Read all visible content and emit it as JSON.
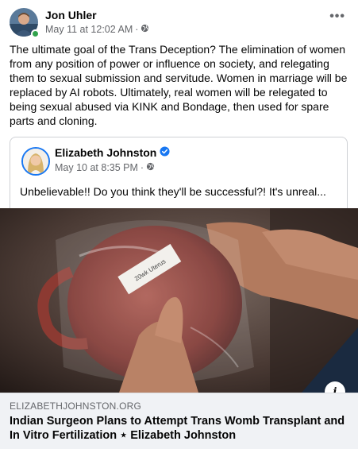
{
  "post": {
    "author_name": "Jon Uhler",
    "timestamp": "May 11 at 12:02 AM",
    "separator": "·",
    "more_label": "•••",
    "privacy_icon": "globe-icon",
    "text": "The ultimate goal of the Trans Deception? The elimination of women from any position of power or influence on society, and relegating them to sexual submission and servitude. Women in marriage will be replaced by AI robots. Ultimately, real women will be relegated to being sexual abused via KINK and Bondage, then used for spare parts and cloning."
  },
  "shared": {
    "author_name": "Elizabeth Johnston",
    "verified_icon": "verified-badge-icon",
    "timestamp": "May 10 at 8:35 PM",
    "separator": "·",
    "privacy_icon": "globe-icon",
    "text": "Unbelievable!! Do you think they'll be successful?! It's unreal..."
  },
  "link": {
    "domain": "ELIZABETHJOHNSTON.ORG",
    "title": "Indian Surgeon Plans to Attempt Trans Womb Transplant and In Vitro Fertilization ⋆ Elizabeth Johnston",
    "image_label": "20wk Uterus",
    "info_label": "i"
  },
  "colors": {
    "accent": "#1877f2",
    "online": "#31a24c",
    "meta_text": "#65676b",
    "footer_bg": "#f0f2f5"
  }
}
